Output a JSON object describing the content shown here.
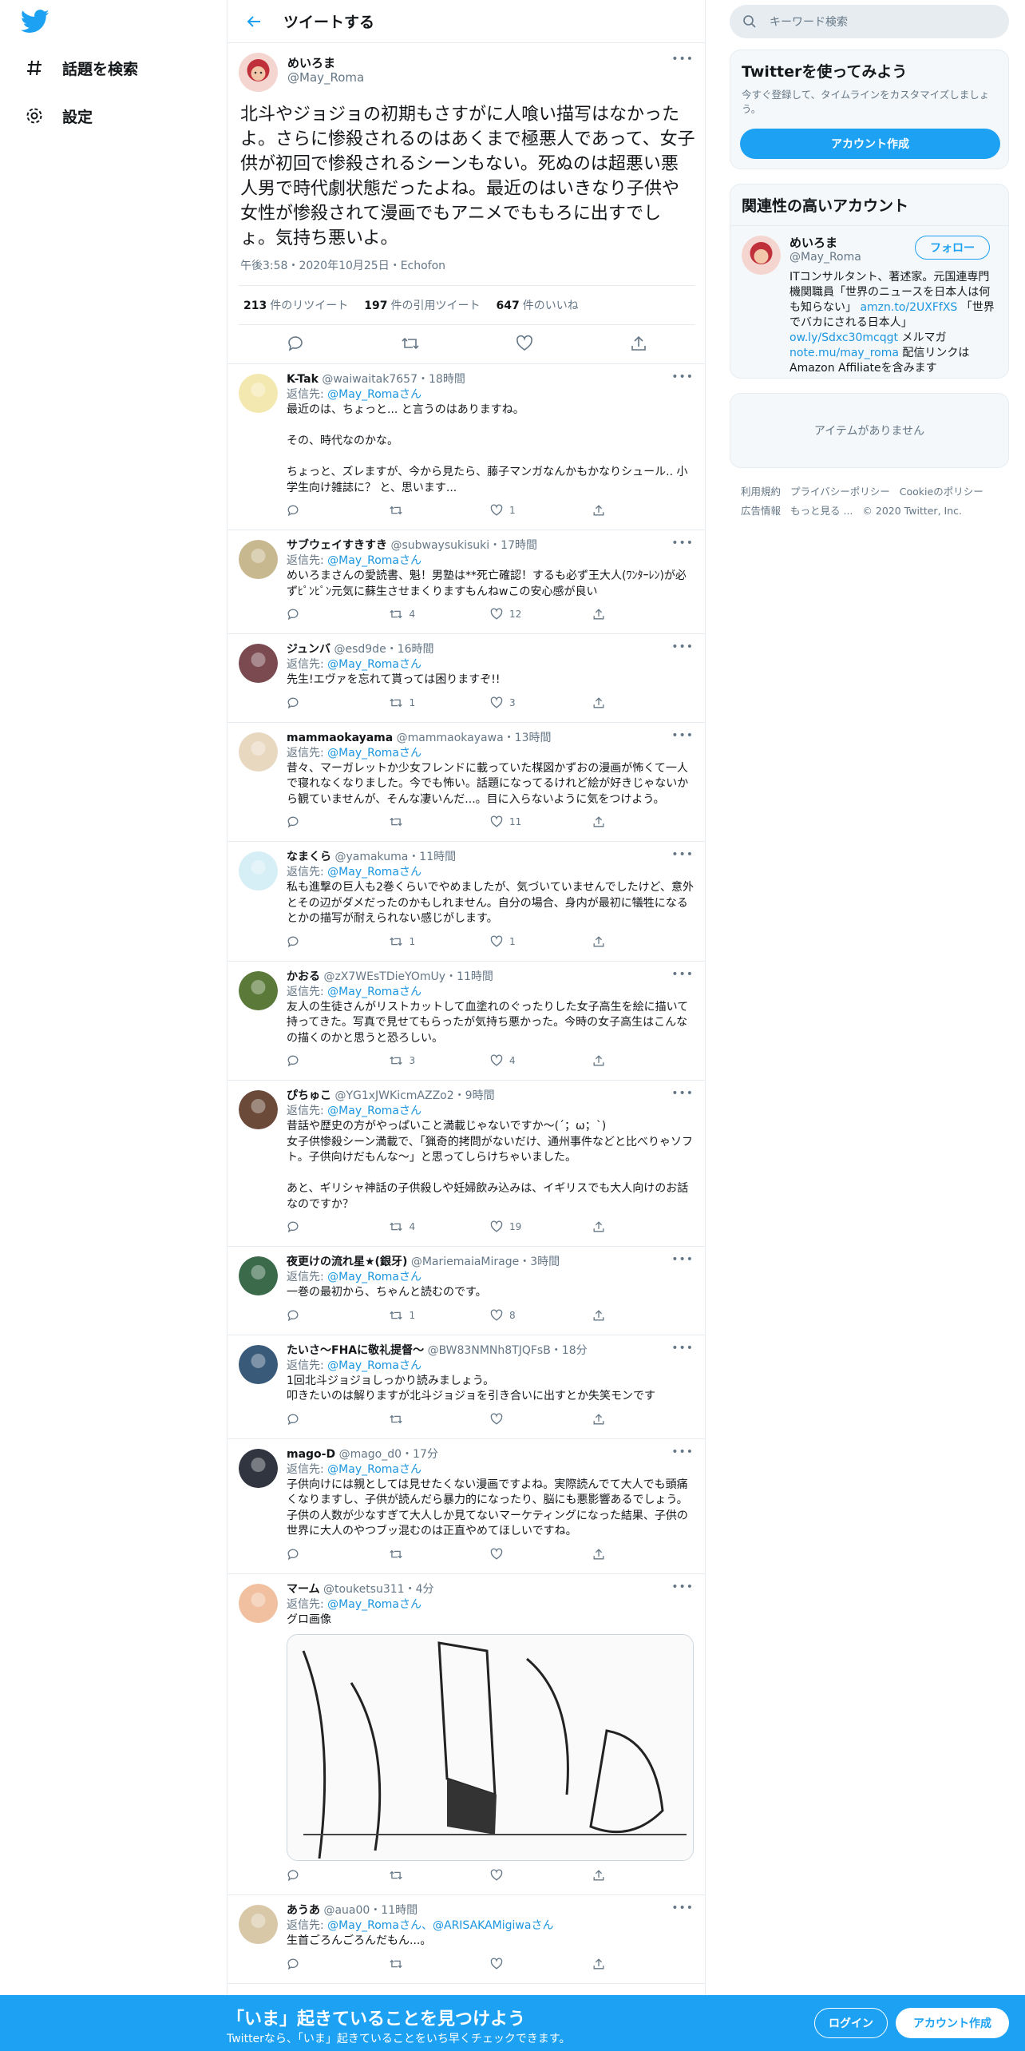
{
  "nav": {
    "explore_label": "話題を検索",
    "settings_label": "設定"
  },
  "header": {
    "title": "ツイートする"
  },
  "main_tweet": {
    "name": "めいろま",
    "handle": "@May_Roma",
    "text": "北斗やジョジョの初期もさすがに人喰い描写はなかったよ。さらに惨殺されるのはあくまで極悪人であって、女子供が初回で惨殺されるシーンもない。死ぬのは超悪い悪人男で時代劇状態だったよね。最近のはいきなり子供や女性が惨殺されて漫画でもアニメでももろに出すでしょ。気持ち悪いよ。",
    "meta": "午後3:58・2020年10月25日・Echofon",
    "retweets": "213",
    "retweets_label": "件のリツイート",
    "quotes": "197",
    "quotes_label": "件の引用ツイート",
    "likes": "647",
    "likes_label": "件のいいね"
  },
  "replies": [
    {
      "name": "K-Tak",
      "handle": "@waiwaitak7657",
      "time": "・18時間",
      "reply_to_label": "返信先: ",
      "reply_to": "@May_Romaさん",
      "body": "最近のは、ちょっと... と言うのはありますね。\n\nその、時代なのかな。\n\nちょっと、ズレますが、今から見たら、藤子マンガなんかもかなりシュール.. 小学生向け雑誌に？ と、思います...",
      "retweets": "",
      "likes": "1",
      "avatar_color": "#f3e9b0"
    },
    {
      "name": "サブウェイすきすき",
      "handle": "@subwaysukisuki",
      "time": "・17時間",
      "reply_to_label": "返信先: ",
      "reply_to": "@May_Romaさん",
      "body": "めいろまさんの愛読書、魁！男塾は**死亡確認！するも必ず王大人(ﾜﾝﾀｰﾚﾝ)が必ずﾋﾟﾝﾋﾟﾝ元気に蘇生させまくりますもんねwこの安心感が良い",
      "retweets": "4",
      "likes": "12",
      "avatar_color": "#c8b890"
    },
    {
      "name": "ジュンバ",
      "handle": "@esd9de",
      "time": "・16時間",
      "reply_to_label": "返信先: ",
      "reply_to": "@May_Romaさん",
      "body": "先生!エヴァを忘れて貰っては困りますぞ!!",
      "retweets": "1",
      "likes": "3",
      "avatar_color": "#7a4a50"
    },
    {
      "name": "mammaokayama",
      "handle": "@mammaokayawa",
      "time": "・13時間",
      "reply_to_label": "返信先: ",
      "reply_to": "@May_Romaさん",
      "body": "昔々、マーガレットか少女フレンドに載っていた楳図かずおの漫画が怖くて一人で寝れなくなりました。今でも怖い。話題になってるけれど絵が好きじゃないから観ていませんが、そんな凄いんだ...。目に入らないように気をつけよう。",
      "retweets": "",
      "likes": "11",
      "avatar_color": "#e8d8c0"
    },
    {
      "name": "なまくら",
      "handle": "@yamakuma",
      "time": "・11時間",
      "reply_to_label": "返信先: ",
      "reply_to": "@May_Romaさん",
      "body": "私も進撃の巨人も2巻くらいでやめましたが、気づいていませんでしたけど、意外とその辺がダメだったのかもしれません。自分の場合、身内が最初に犠牲になるとかの描写が耐えられない感じがします。",
      "retweets": "1",
      "likes": "1",
      "avatar_color": "#d6eef5"
    },
    {
      "name": "かおる",
      "handle": "@zX7WEsTDieYOmUy",
      "time": "・11時間",
      "reply_to_label": "返信先: ",
      "reply_to": "@May_Romaさん",
      "body": "友人の生徒さんがリストカットして血塗れのぐったりした女子高生を絵に描いて持ってきた。写真で見せてもらったが気持ち悪かった。今時の女子高生はこんなの描くのかと思うと恐ろしい。",
      "retweets": "3",
      "likes": "4",
      "avatar_color": "#5b7a3a"
    },
    {
      "name": "ぴちゅこ",
      "handle": "@YG1xJWKicmAZZo2",
      "time": "・9時間",
      "reply_to_label": "返信先: ",
      "reply_to": "@May_Romaさん",
      "body": "昔話や歴史の方がやっぱいこと満載じゃないですか〜(´；ω；`)\n女子供惨殺シーン満載で、「猟奇的拷問がないだけ、通州事件などと比べりゃソフト。子供向けだもんな〜」と思ってしらけちゃいました。\n\nあと、ギリシャ神話の子供殺しや妊婦飲み込みは、イギリスでも大人向けのお話なのですか？",
      "retweets": "4",
      "likes": "19",
      "avatar_color": "#6b4a3a"
    },
    {
      "name": "夜更けの流れ星★(銀牙)",
      "handle": "@MariemaiaMirage",
      "time": "・3時間",
      "reply_to_label": "返信先: ",
      "reply_to": "@May_Romaさん",
      "body": "一巻の最初から、ちゃんと読むのです。",
      "retweets": "1",
      "likes": "8",
      "avatar_color": "#3a6a4a"
    },
    {
      "name": "たいさ～FHAに敬礼提督～",
      "handle": "@BW83NMNh8TJQFsB",
      "time": "・18分",
      "reply_to_label": "返信先: ",
      "reply_to": "@May_Romaさん",
      "body": "1回北斗ジョジョしっかり読みましょう。\n叩きたいのは解りますが北斗ジョジョを引き合いに出すとか失笑モンです",
      "retweets": "",
      "likes": "",
      "avatar_color": "#3a5a7a"
    },
    {
      "name": "mago-D",
      "handle": "@mago_d0",
      "time": "・17分",
      "reply_to_label": "返信先: ",
      "reply_to": "@May_Romaさん",
      "body": "子供向けには親としては見せたくない漫画ですよね。実際読んでて大人でも頭痛くなりますし、子供が読んだら暴力的になったり、脳にも悪影響あるでしょう。\n子供の人数が少なすぎて大人しか見てないマーケティングになった結果、子供の世界に大人のやつブッ混むのは正直やめてほしいですね。",
      "retweets": "",
      "likes": "",
      "avatar_color": "#303540"
    },
    {
      "name": "マーム",
      "handle": "@touketsu311",
      "time": "・4分",
      "reply_to_label": "返信先: ",
      "reply_to": "@May_Romaさん",
      "body": "グロ画像",
      "retweets": "",
      "likes": "",
      "avatar_color": "#f0c0a0",
      "has_media": true
    },
    {
      "name": "あうあ",
      "handle": "@aua00",
      "time": "・11時間",
      "reply_to_label": "返信先: ",
      "reply_to": "@May_Romaさん、@ARISAKAMigiwaさん",
      "body": "生首ごろんごろんだもん...。",
      "retweets": "",
      "likes": "",
      "avatar_color": "#d8c8a8"
    }
  ],
  "sidebar": {
    "search_placeholder": "キーワード検索",
    "try_title": "Twitterを使ってみよう",
    "try_sub": "今すぐ登録して、タイムラインをカスタマイズしましょう。",
    "signup_btn": "アカウント作成",
    "related_title": "関連性の高いアカウント",
    "acct_name": "めいろま",
    "acct_handle": "@May_Roma",
    "follow_btn": "フォロー",
    "bio_1": "ITコンサルタント、著述家。元国連専門機関職員「世界のニュースを日本人は何も知らない」",
    "bio_link1": "amzn.to/2UXFfXS",
    "bio_2": "「世界でバカにされる日本人」",
    "bio_link2": "ow.ly/Sdxc30mcqgt",
    "bio_3": " メルマガ ",
    "bio_link3": "note.mu/may_roma",
    "bio_4": " 配信リンクはAmazon Affiliateを含みます",
    "empty": "アイテムがありません",
    "footer_1": "利用規約",
    "footer_2": "プライバシーポリシー",
    "footer_3": "Cookieのポリシー",
    "footer_4": "広告情報",
    "footer_5": "もっと見る ...",
    "footer_6": "© 2020 Twitter, Inc."
  },
  "bottom_bar": {
    "title": "「いま」起きていることを見つけよう",
    "sub": "Twitterなら、「いま」起きていることをいち早くチェックできます。",
    "login": "ログイン",
    "signup": "アカウント作成"
  },
  "colors": {
    "accent": "#1da1f2",
    "muted": "#657786",
    "border": "#e6ecf0"
  }
}
